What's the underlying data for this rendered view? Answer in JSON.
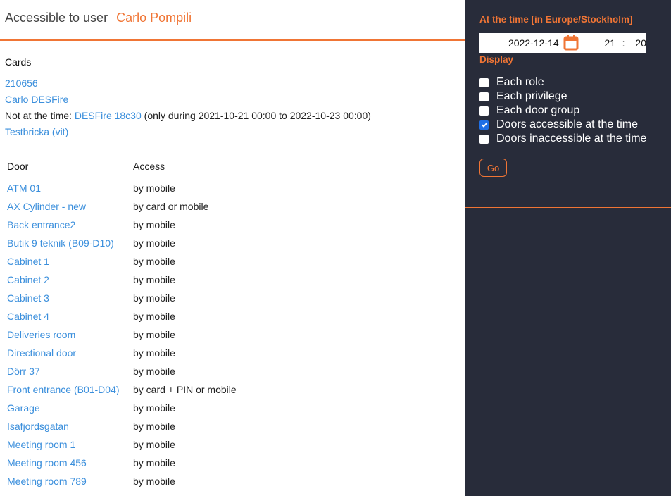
{
  "header": {
    "label": "Accessible to user",
    "user_name": "Carlo Pompili"
  },
  "cards": {
    "title": "Cards",
    "items": [
      {
        "name": "210656"
      },
      {
        "name": "Carlo DESFire"
      },
      {
        "prefix": "Not at the time:",
        "name": "DESFire 18c30",
        "suffix": "(only during 2021-10-21 00:00 to 2022-10-23 00:00)"
      },
      {
        "name": "Testbricka (vit)"
      }
    ]
  },
  "doors_table": {
    "headers": [
      "Door",
      "Access"
    ],
    "rows": [
      {
        "door": "ATM 01",
        "access": "by mobile"
      },
      {
        "door": "AX Cylinder - new",
        "access": "by card or mobile"
      },
      {
        "door": "Back entrance2",
        "access": "by mobile"
      },
      {
        "door": "Butik 9 teknik (B09-D10)",
        "access": "by mobile"
      },
      {
        "door": "Cabinet 1",
        "access": "by mobile"
      },
      {
        "door": "Cabinet 2",
        "access": "by mobile"
      },
      {
        "door": "Cabinet 3",
        "access": "by mobile"
      },
      {
        "door": "Cabinet 4",
        "access": "by mobile"
      },
      {
        "door": "Deliveries room",
        "access": "by mobile"
      },
      {
        "door": "Directional door",
        "access": "by mobile"
      },
      {
        "door": "Dörr 37",
        "access": "by mobile"
      },
      {
        "door": "Front entrance (B01-D04)",
        "access": "by card + PIN or mobile"
      },
      {
        "door": "Garage",
        "access": "by mobile"
      },
      {
        "door": "Isafjordsgatan",
        "access": "by mobile"
      },
      {
        "door": "Meeting room 1",
        "access": "by mobile"
      },
      {
        "door": "Meeting room 456",
        "access": "by mobile"
      },
      {
        "door": "Meeting room 789",
        "access": "by mobile"
      }
    ]
  },
  "sidebar": {
    "time_title": "At the time [in Europe/Stockholm]",
    "date": "2022-12-14",
    "calendar_icon": "calendar-icon",
    "hour": "21",
    "time_separator": ":",
    "minute": "20",
    "display_title": "Display",
    "options": [
      {
        "label": "Each role",
        "checked": false
      },
      {
        "label": "Each privilege",
        "checked": false
      },
      {
        "label": "Each door group",
        "checked": false
      },
      {
        "label": "Doors accessible at the time",
        "checked": true
      },
      {
        "label": "Doors inaccessible at the time",
        "checked": false
      }
    ],
    "go_label": "Go"
  },
  "colors": {
    "accent": "#f07535",
    "link": "#3b8fdc",
    "sidebar_bg": "#282c3a",
    "checkbox_checked": "#1f6fe5"
  }
}
